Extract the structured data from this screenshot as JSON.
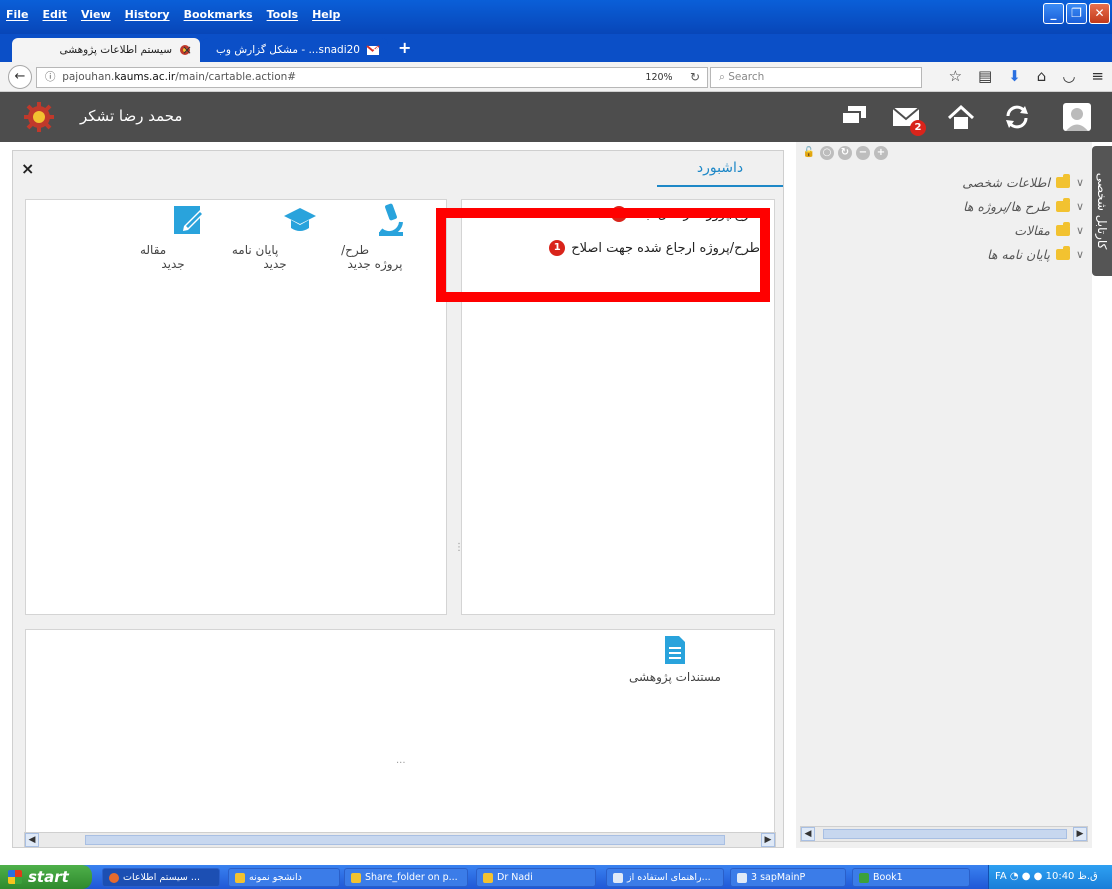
{
  "browser": {
    "menu": [
      "File",
      "Edit",
      "View",
      "History",
      "Bookmarks",
      "Tools",
      "Help"
    ],
    "tabs": [
      {
        "title": "سیستم اطلاعات پژوهشی",
        "close": "×"
      },
      {
        "title": "snadi20... - مشکل گزارش وب",
        "close": "×"
      }
    ],
    "new_tab": "+",
    "url_prefix": "pajouhan.",
    "url_host": "kaums.ac.ir",
    "url_path": "/main/cartable.action#",
    "zoom": "120%",
    "search_placeholder": "Search"
  },
  "app": {
    "user_name": "محمد رضا تشکر",
    "mail_badge": "2"
  },
  "dashboard": {
    "close": "×",
    "tab_label": "داشبورد",
    "quick_actions": [
      {
        "label": "طرح/پروژه جدید",
        "icon": "microscope-icon"
      },
      {
        "label": "پایان نامه جدید",
        "icon": "graduation-cap-icon"
      },
      {
        "label": "مقاله جدید",
        "icon": "edit-document-icon"
      }
    ],
    "cartable": [
      {
        "label": "طرح/پروژه در حال ثبت",
        "count": "1"
      },
      {
        "label": "طرح/پروژه ارجاع شده جهت اصلاح",
        "count": "1"
      }
    ],
    "documents_label": "مستندات پژوهشی",
    "resize_v": "⋮",
    "resize_h": "···"
  },
  "sidebar": {
    "tab_label": "کارتابل شخصی",
    "tree": [
      {
        "label": "اطلاعات شخصی"
      },
      {
        "label": "طرح ها/پروژه ها"
      },
      {
        "label": "مقالات"
      },
      {
        "label": "پایان نامه ها"
      }
    ]
  },
  "taskbar": {
    "start": "start",
    "items": [
      {
        "label": "سیستم اطلاعات ..."
      },
      {
        "label": "دانشجو نمونه"
      },
      {
        "label": "Share_folder on p..."
      },
      {
        "label": "Dr Nadi"
      },
      {
        "label": "راهنمای استفاده از..."
      },
      {
        "label": "3 sapMainP"
      },
      {
        "label": "Book1"
      }
    ],
    "lang": "FA",
    "clock": "10:40 ق.ظ"
  },
  "colors": {
    "accent": "#1e88c7",
    "highlight": "#ff0000",
    "header": "#4d4d4d"
  }
}
